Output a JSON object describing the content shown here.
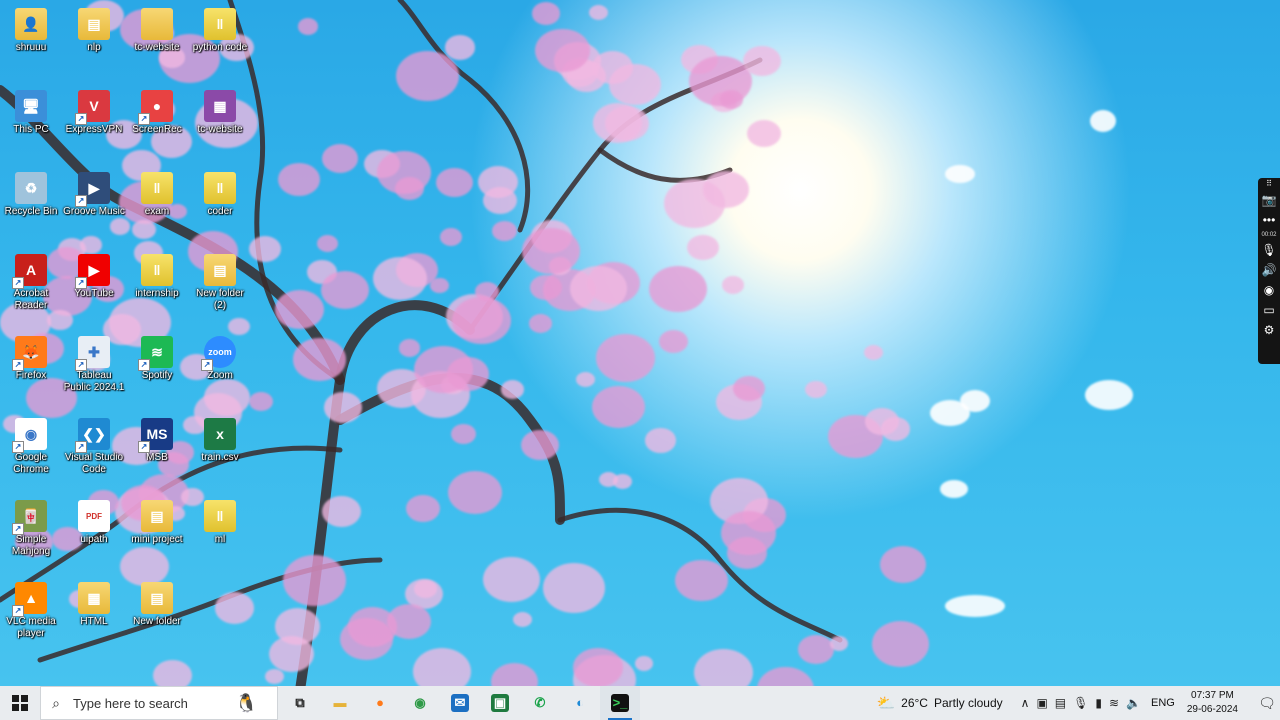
{
  "desktop": {
    "icons": [
      {
        "label": "shruuu",
        "kind": "folder-user",
        "shortcut": false
      },
      {
        "label": "nlp",
        "kind": "folder-doc",
        "shortcut": false
      },
      {
        "label": "tc-website",
        "kind": "folder",
        "shortcut": false
      },
      {
        "label": "python code",
        "kind": "zip-folder",
        "shortcut": false
      },
      {
        "label": "This PC",
        "kind": "this-pc",
        "shortcut": false
      },
      {
        "label": "ExpressVPN",
        "kind": "expressvpn",
        "shortcut": true
      },
      {
        "label": "ScreenRec",
        "kind": "screenrec",
        "shortcut": true
      },
      {
        "label": "tc-website",
        "kind": "winrar",
        "shortcut": false
      },
      {
        "label": "Recycle Bin",
        "kind": "recycle-bin",
        "shortcut": false
      },
      {
        "label": "Groove Music",
        "kind": "groove",
        "shortcut": true
      },
      {
        "label": "exam",
        "kind": "zip-folder",
        "shortcut": false
      },
      {
        "label": "coder",
        "kind": "zip-folder",
        "shortcut": false
      },
      {
        "label": "Acrobat Reader",
        "kind": "acrobat",
        "shortcut": true
      },
      {
        "label": "YouTube",
        "kind": "youtube",
        "shortcut": true
      },
      {
        "label": "internship",
        "kind": "zip-folder",
        "shortcut": false
      },
      {
        "label": "New folder (2)",
        "kind": "folder-doc",
        "shortcut": false
      },
      {
        "label": "Firefox",
        "kind": "firefox",
        "shortcut": true
      },
      {
        "label": "Tableau Public 2024.1",
        "kind": "tableau",
        "shortcut": true
      },
      {
        "label": "Spotify",
        "kind": "spotify",
        "shortcut": true
      },
      {
        "label": "Zoom",
        "kind": "zoom",
        "shortcut": true
      },
      {
        "label": "Google Chrome",
        "kind": "chrome",
        "shortcut": true
      },
      {
        "label": "Visual Studio Code",
        "kind": "vscode",
        "shortcut": true
      },
      {
        "label": "MSB",
        "kind": "msb",
        "shortcut": true
      },
      {
        "label": "train.csv",
        "kind": "csv",
        "shortcut": false
      },
      {
        "label": "Simple Mahjong",
        "kind": "mahjong",
        "shortcut": true
      },
      {
        "label": "uipath",
        "kind": "pdf-file",
        "shortcut": false
      },
      {
        "label": "mini project",
        "kind": "folder-doc",
        "shortcut": false
      },
      {
        "label": "ml",
        "kind": "zip-folder",
        "shortcut": false
      },
      {
        "label": "VLC media player",
        "kind": "vlc",
        "shortcut": true
      },
      {
        "label": "HTML",
        "kind": "html-folder",
        "shortcut": false
      },
      {
        "label": "New folder",
        "kind": "folder-doc",
        "shortcut": false
      }
    ]
  },
  "recorder": {
    "time": "00:02",
    "buttons": [
      "drag-handle",
      "camera",
      "more",
      "microphone",
      "speaker",
      "webcam",
      "screen",
      "settings"
    ]
  },
  "taskbar": {
    "search_placeholder": "Type here to search",
    "pinned": [
      {
        "name": "task-view",
        "active": false
      },
      {
        "name": "file-explorer",
        "active": false
      },
      {
        "name": "firefox",
        "active": false
      },
      {
        "name": "chrome",
        "active": false
      },
      {
        "name": "mail",
        "active": false
      },
      {
        "name": "excel-app",
        "active": false
      },
      {
        "name": "whatsapp",
        "active": false
      },
      {
        "name": "edge",
        "active": false
      },
      {
        "name": "terminal",
        "active": true
      }
    ],
    "weather": {
      "temp": "26°C",
      "condition": "Partly cloudy"
    },
    "language": "ENG",
    "time": "07:37 PM",
    "date": "29-06-2024"
  }
}
